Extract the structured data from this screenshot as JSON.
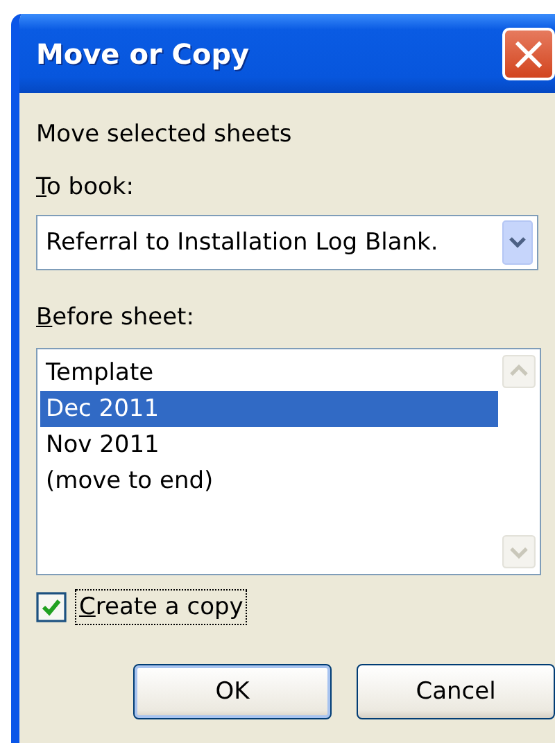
{
  "window": {
    "title": "Move or Copy",
    "close_glyph": "×"
  },
  "instruction": "Move selected sheets",
  "to_book": {
    "label": "To book:",
    "underline_first": true,
    "value": "Referral to Installation Log Blank."
  },
  "before_sheet": {
    "label": "Before sheet:",
    "underline_first": true,
    "items": [
      {
        "label": "Template",
        "selected": false
      },
      {
        "label": "Dec 2011",
        "selected": true
      },
      {
        "label": "Nov 2011",
        "selected": false
      },
      {
        "label": "(move to end)",
        "selected": false
      }
    ]
  },
  "create_copy": {
    "label": "Create a copy",
    "underline_first": true,
    "checked": true,
    "focused": true
  },
  "buttons": [
    {
      "label": "OK",
      "default": true
    },
    {
      "label": "Cancel",
      "default": false
    }
  ]
}
